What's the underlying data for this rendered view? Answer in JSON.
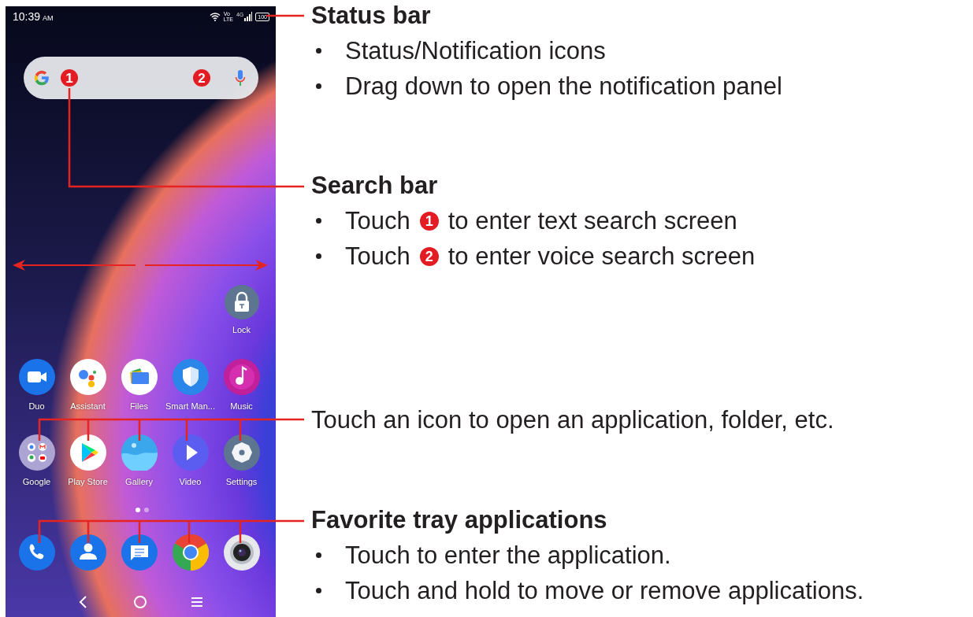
{
  "phone": {
    "status_bar": {
      "time": "10:39",
      "meridiem": "AM",
      "volte": [
        "Vo",
        "LTE"
      ],
      "network": "4G",
      "battery": "100"
    },
    "search_bar": {
      "markers": [
        "1",
        "2"
      ]
    },
    "lock": {
      "label": "Lock"
    },
    "app_rows": [
      [
        {
          "label": "Duo"
        },
        {
          "label": "Assistant"
        },
        {
          "label": "Files"
        },
        {
          "label": "Smart Man..."
        },
        {
          "label": "Music"
        }
      ],
      [
        {
          "label": "Google"
        },
        {
          "label": "Play Store"
        },
        {
          "label": "Gallery"
        },
        {
          "label": "Video"
        },
        {
          "label": "Settings"
        }
      ]
    ],
    "page_dots": [
      {
        "selected": true
      },
      {
        "selected": false
      }
    ]
  },
  "annotations": [
    {
      "kind": "titled",
      "heading": "Status bar",
      "bullets": [
        [
          {
            "text": "Status/Notification icons"
          }
        ],
        [
          {
            "text": "Drag down to open the notification panel"
          }
        ]
      ]
    },
    {
      "kind": "titled",
      "heading": "Search bar",
      "bullets": [
        [
          {
            "text": "Touch"
          },
          {
            "marker": "1"
          },
          {
            "text": "to enter text search screen"
          }
        ],
        [
          {
            "text": "Touch"
          },
          {
            "marker": "2"
          },
          {
            "text": "to enter voice search screen"
          }
        ]
      ]
    },
    {
      "kind": "plain",
      "text": "Touch an icon to open an application, folder, etc."
    },
    {
      "kind": "titled",
      "heading": "Favorite tray applications",
      "bullets": [
        [
          {
            "text": "Touch to enter the application."
          }
        ],
        [
          {
            "text": "Touch and hold to move or remove applications."
          }
        ]
      ]
    }
  ]
}
